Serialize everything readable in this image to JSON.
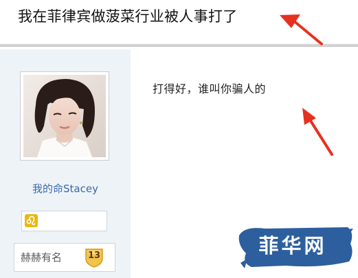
{
  "thread": {
    "title": "我在菲律宾做菠菜行业被人事打了"
  },
  "reply": {
    "text": "打得好，谁叫你骗人的"
  },
  "user": {
    "name": "我的命Stacey",
    "zodiac_icon": "leo-zodiac-icon",
    "level_name": "赫赫有名",
    "level": "13"
  },
  "watermark": {
    "text": "菲华网"
  },
  "colors": {
    "annotation_arrow": "#e8301f",
    "username_link": "#3a69a8",
    "panel_bg": "#eef3f8",
    "watermark_blue": "#2d5f9e",
    "zodiac_yellow": "#e8b814",
    "level_badge_gold": "#f2c24c"
  }
}
